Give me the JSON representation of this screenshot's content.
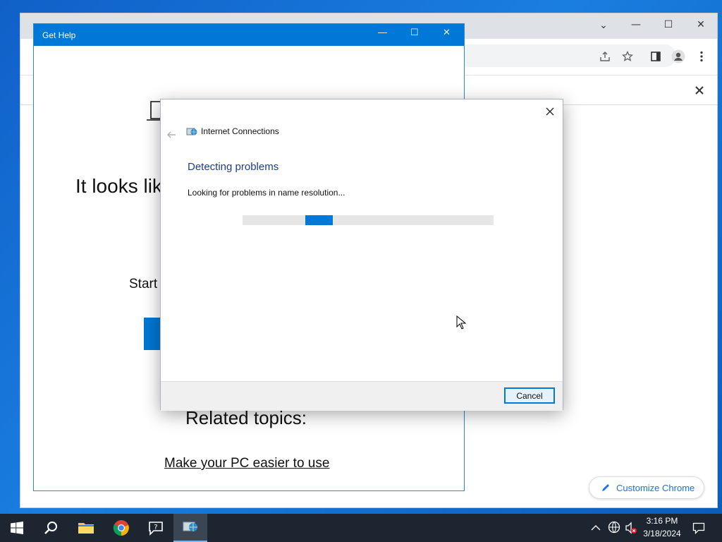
{
  "chrome": {
    "icons": [
      "chevron-down-icon",
      "minimize-icon",
      "maximize-icon",
      "close-icon",
      "share-icon",
      "star-icon",
      "side-panel-icon",
      "profile-icon",
      "more-icon",
      "close-infobar-icon"
    ],
    "customize_label": "Customize Chrome"
  },
  "get_help": {
    "title": "Get Help",
    "headline_partial": "It looks lik",
    "start_partial": "Start",
    "related_heading": "Related topics:",
    "related_link": "Make your PC easier to use"
  },
  "dialog": {
    "title": "Internet Connections",
    "heading": "Detecting problems",
    "status": "Looking for problems in name resolution...",
    "progress": 0.25,
    "cancel_label": "Cancel"
  },
  "taskbar": {
    "apps": [
      "start-icon",
      "search-icon",
      "file-explorer-icon",
      "chrome-icon",
      "get-help-icon",
      "troubleshooter-icon"
    ],
    "time": "3:16 PM",
    "date": "3/18/2024",
    "accent": "#0078d7"
  }
}
